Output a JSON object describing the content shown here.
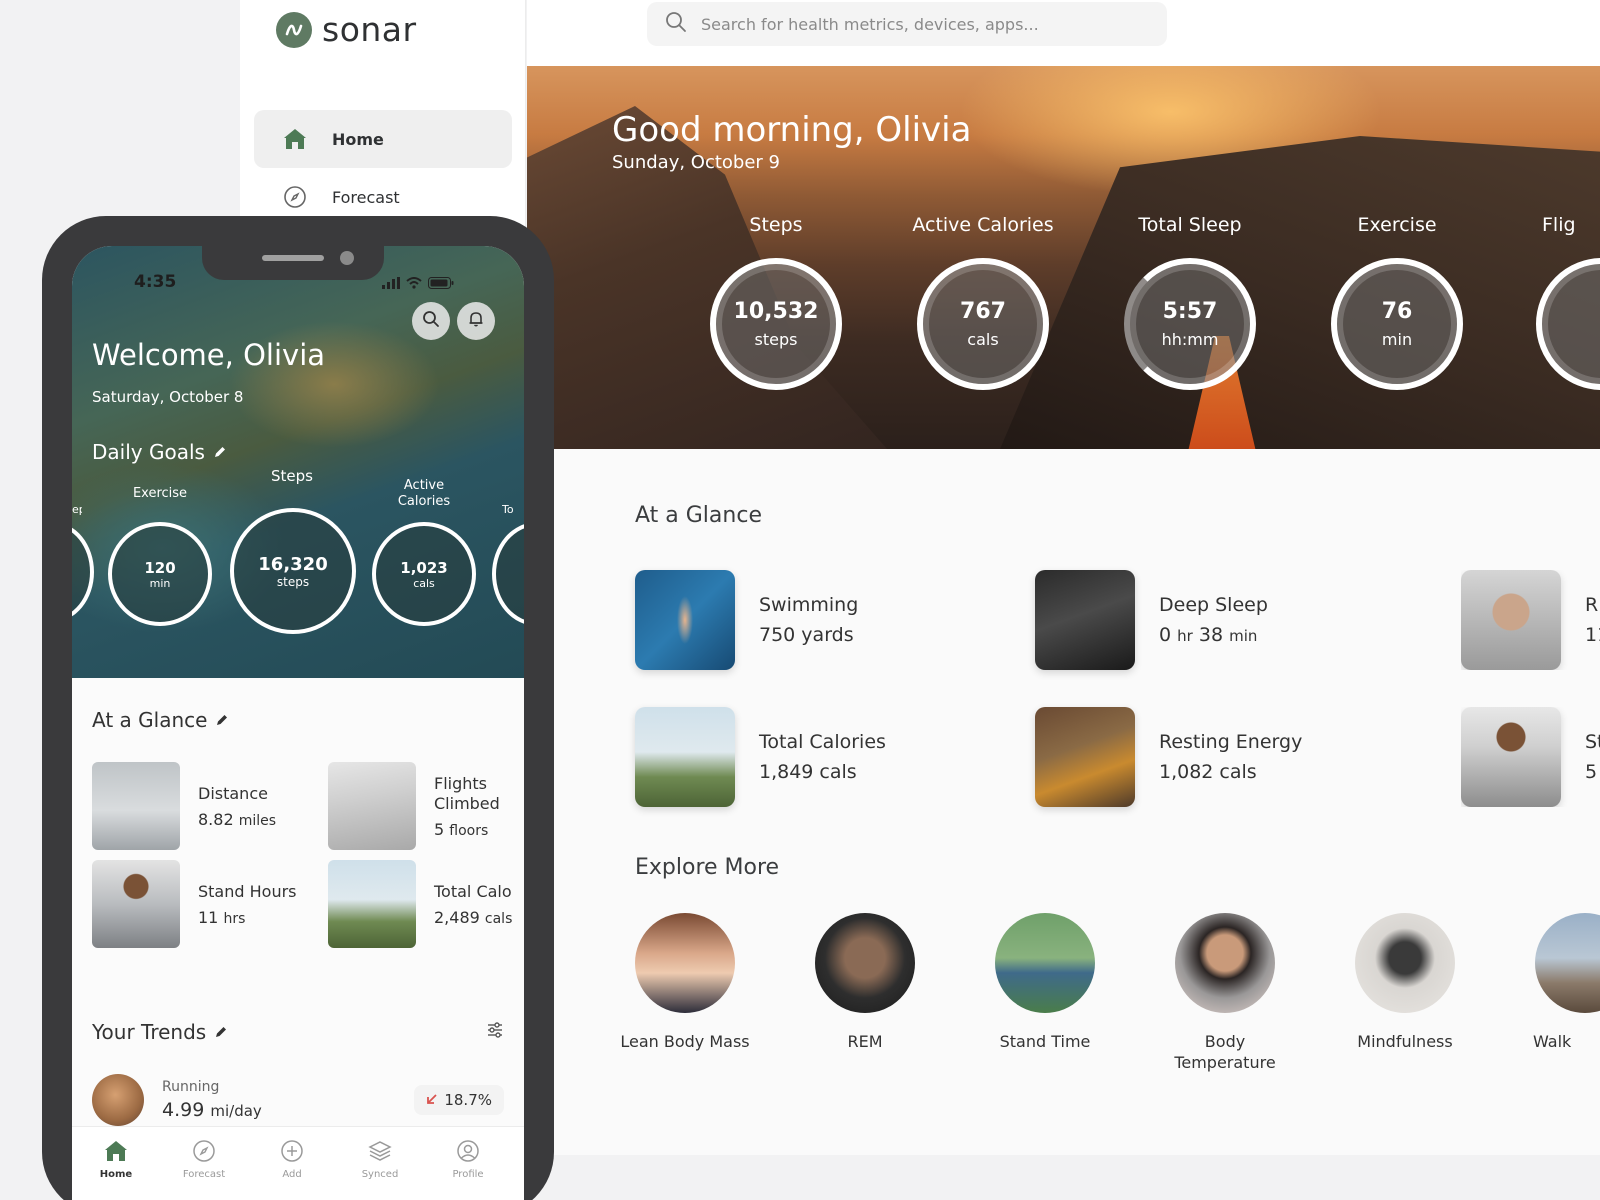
{
  "colors": {
    "brand": "#5f7a63",
    "accent_green": "#4d7a55",
    "down_arrow": "#d9534f"
  },
  "brand": {
    "name": "sonar"
  },
  "sidebar": {
    "items": [
      {
        "label": "Home",
        "icon": "home-icon",
        "active": true
      },
      {
        "label": "Forecast",
        "icon": "compass-icon",
        "active": false
      }
    ]
  },
  "search": {
    "placeholder": "Search for health metrics, devices, apps..."
  },
  "hero": {
    "greeting": "Good morning, Olivia",
    "date": "Sunday, October 9",
    "rings": [
      {
        "label": "Steps",
        "value": "10,532",
        "unit": "steps"
      },
      {
        "label": "Active Calories",
        "value": "767",
        "unit": "cals"
      },
      {
        "label": "Total Sleep",
        "value": "5:57",
        "unit": "hh:mm"
      },
      {
        "label": "Exercise",
        "value": "76",
        "unit": "min"
      },
      {
        "label": "Flig"
      }
    ]
  },
  "glance": {
    "title": "At a Glance",
    "cards": [
      {
        "title": "Swimming",
        "value": "750 yards"
      },
      {
        "title": "Deep Sleep",
        "value_hr": "0",
        "hr_unit": "hr",
        "value_min": "38",
        "min_unit": "min"
      },
      {
        "title": "R",
        "value": "11."
      },
      {
        "title": "Total Calories",
        "value": "1,849 cals"
      },
      {
        "title": "Resting Energy",
        "value": "1,082 cals"
      },
      {
        "title": "St",
        "value": "5"
      }
    ]
  },
  "explore": {
    "title": "Explore More",
    "items": [
      {
        "label": "Lean Body Mass"
      },
      {
        "label": "REM"
      },
      {
        "label": "Stand Time"
      },
      {
        "label": "Body Temperature"
      },
      {
        "label": "Mindfulness"
      },
      {
        "label": "Walk"
      }
    ]
  },
  "phone": {
    "time": "4:35",
    "welcome": "Welcome, Olivia",
    "date": "Saturday, October 8",
    "goals_title": "Daily Goals",
    "goals": [
      {
        "label": "ep"
      },
      {
        "label": "Exercise",
        "value": "120",
        "unit": "min"
      },
      {
        "label": "Steps",
        "value": "16,320",
        "unit": "steps"
      },
      {
        "label_line1": "Active",
        "label_line2": "Calories",
        "value": "1,023",
        "unit": "cals"
      },
      {
        "label": "To"
      }
    ],
    "glance_title": "At a Glance",
    "glance": [
      {
        "title": "Distance",
        "value": "8.82",
        "unit": "miles"
      },
      {
        "title_line1": "Flights",
        "title_line2": "Climbed",
        "value": "5",
        "unit": "floors"
      },
      {
        "title": "Stand Hours",
        "value": "11",
        "unit": "hrs"
      },
      {
        "title": "Total Calo",
        "value": "2,489",
        "unit": "cals"
      }
    ],
    "trends_title": "Your Trends",
    "trend": {
      "label": "Running",
      "value": "4.99",
      "unit": "mi/day",
      "change": "18.7%",
      "direction": "down"
    },
    "tabs": [
      {
        "label": "Home",
        "icon": "home-icon",
        "active": true
      },
      {
        "label": "Forecast",
        "icon": "compass-icon",
        "active": false
      },
      {
        "label": "Add",
        "icon": "plus-circle-icon",
        "active": false
      },
      {
        "label": "Synced",
        "icon": "layers-icon",
        "active": false
      },
      {
        "label": "Profile",
        "icon": "profile-icon",
        "active": false
      }
    ]
  }
}
